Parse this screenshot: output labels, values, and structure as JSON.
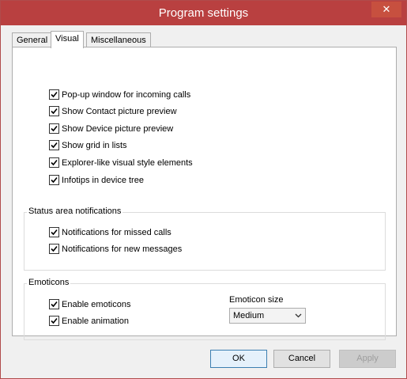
{
  "window": {
    "title": "Program settings",
    "close_glyph": "✕"
  },
  "tabs": [
    {
      "label": "General"
    },
    {
      "label": "Visual"
    },
    {
      "label": "Miscellaneous"
    }
  ],
  "visual": {
    "options": [
      {
        "label": "Pop-up window for incoming calls",
        "checked": true
      },
      {
        "label": "Show Contact picture preview",
        "checked": true
      },
      {
        "label": "Show Device picture preview",
        "checked": true
      },
      {
        "label": "Show grid in lists",
        "checked": true
      },
      {
        "label": "Explorer-like visual style elements",
        "checked": true
      },
      {
        "label": "Infotips in device tree",
        "checked": true
      }
    ],
    "status_area": {
      "title": "Status area notifications",
      "options": [
        {
          "label": "Notifications for missed calls",
          "checked": true
        },
        {
          "label": "Notifications for new messages",
          "checked": true
        }
      ]
    },
    "emoticons": {
      "title": "Emoticons",
      "options": [
        {
          "label": "Enable emoticons",
          "checked": true
        },
        {
          "label": "Enable animation",
          "checked": true
        }
      ],
      "size_label": "Emoticon size",
      "size_value": "Medium"
    }
  },
  "buttons": {
    "ok": "OK",
    "cancel": "Cancel",
    "apply": "Apply"
  },
  "colors": {
    "titlebar": "#b94040",
    "close": "#c7503f"
  },
  "icons": {
    "checkbox_checked": "check-mark-icon",
    "dropdown": "chevron-down-icon"
  }
}
